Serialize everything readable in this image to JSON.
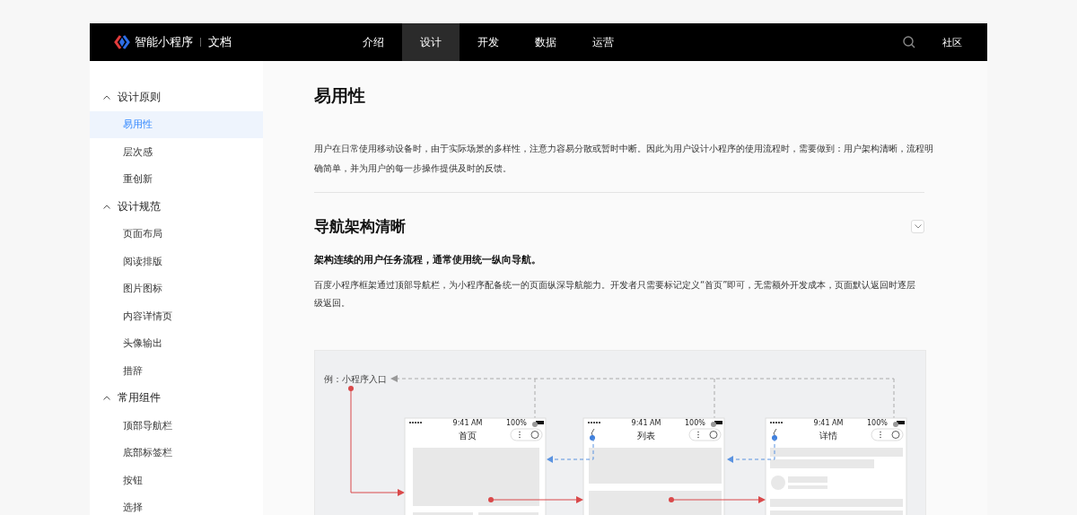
{
  "header": {
    "logo_text": "智能小程序",
    "section": "文档",
    "nav": [
      {
        "label": "介绍",
        "selected": false
      },
      {
        "label": "设计",
        "selected": true
      },
      {
        "label": "开发",
        "selected": false
      },
      {
        "label": "数据",
        "selected": false
      },
      {
        "label": "运营",
        "selected": false
      }
    ],
    "community": "社区"
  },
  "sidebar": {
    "groups": [
      {
        "title": "设计原则",
        "expanded": true,
        "items": [
          {
            "label": "易用性",
            "selected": true
          },
          {
            "label": "层次感",
            "selected": false
          },
          {
            "label": "重创新",
            "selected": false
          }
        ]
      },
      {
        "title": "设计规范",
        "expanded": true,
        "items": [
          {
            "label": "页面布局",
            "selected": false
          },
          {
            "label": "阅读排版",
            "selected": false
          },
          {
            "label": "图片图标",
            "selected": false
          },
          {
            "label": "内容详情页",
            "selected": false
          },
          {
            "label": "头像输出",
            "selected": false
          },
          {
            "label": "措辞",
            "selected": false
          }
        ]
      },
      {
        "title": "常用组件",
        "expanded": true,
        "items": [
          {
            "label": "顶部导航栏",
            "selected": false
          },
          {
            "label": "底部标签栏",
            "selected": false
          },
          {
            "label": "按钮",
            "selected": false
          },
          {
            "label": "选择",
            "selected": false
          }
        ]
      }
    ]
  },
  "article": {
    "title": "易用性",
    "intro": "用户在日常使用移动设备时，由于实际场景的多样性，注意力容易分散或暂时中断。因此为用户设计小程序的使用流程时，需要做到：用户架构清晰，流程明确简单，并为用户的每一步操作提供及时的反馈。",
    "sections": [
      {
        "title": "导航架构清晰",
        "subtitle": "架构连续的用户任务流程，通常使用统一纵向导航。",
        "body": "百度小程序框架通过顶部导航栏，为小程序配备统一的页面纵深导航能力。开发者只需要标记定义“首页”即可，无需额外开发成本，页面默认返回时逐层级返回。"
      }
    ]
  },
  "diagram": {
    "entry_label": "例：小程序入口",
    "screens": [
      {
        "time": "9:41 AM",
        "battery": "100%",
        "title": "首页",
        "has_back": false
      },
      {
        "time": "9:41 AM",
        "battery": "100%",
        "title": "列表",
        "has_back": true
      },
      {
        "time": "9:41 AM",
        "battery": "100%",
        "title": "详情",
        "has_back": true
      }
    ]
  }
}
